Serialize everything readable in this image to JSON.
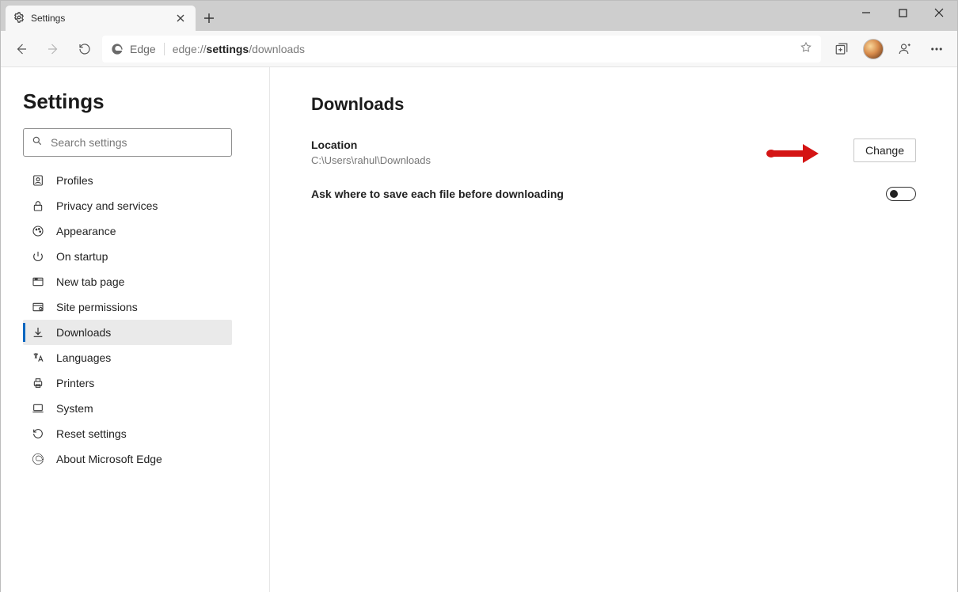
{
  "window": {
    "tab_title": "Settings"
  },
  "toolbar": {
    "brand_label": "Edge",
    "url_scheme": "edge://",
    "url_bold": "settings",
    "url_rest": "/downloads"
  },
  "sidebar": {
    "title": "Settings",
    "search_placeholder": "Search settings",
    "items": [
      {
        "label": "Profiles"
      },
      {
        "label": "Privacy and services"
      },
      {
        "label": "Appearance"
      },
      {
        "label": "On startup"
      },
      {
        "label": "New tab page"
      },
      {
        "label": "Site permissions"
      },
      {
        "label": "Downloads"
      },
      {
        "label": "Languages"
      },
      {
        "label": "Printers"
      },
      {
        "label": "System"
      },
      {
        "label": "Reset settings"
      },
      {
        "label": "About Microsoft Edge"
      }
    ],
    "active_index": 6
  },
  "content": {
    "title": "Downloads",
    "location_label": "Location",
    "location_value": "C:\\Users\\rahul\\Downloads",
    "change_label": "Change",
    "ask_label": "Ask where to save each file before downloading",
    "ask_value": false
  }
}
